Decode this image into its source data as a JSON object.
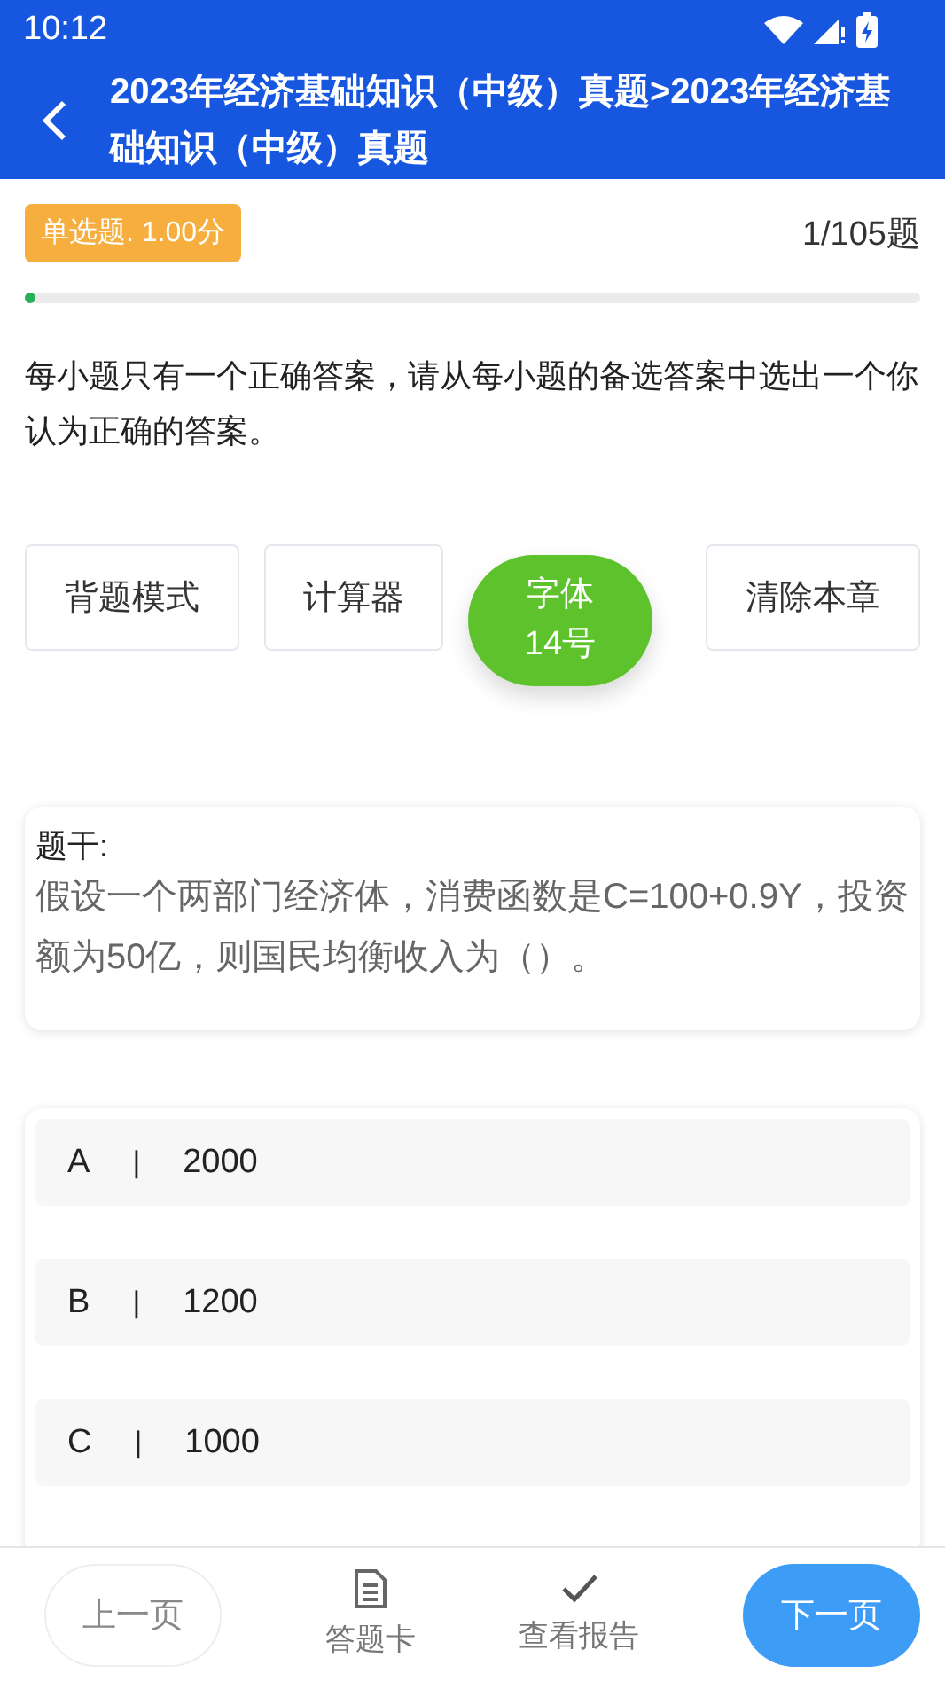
{
  "status_bar": {
    "time": "10:12"
  },
  "header": {
    "title": "2023年经济基础知识（中级）真题>2023年经济基础知识（中级）真题"
  },
  "question_info": {
    "type_tag": "单选题. 1.00分",
    "counter": "1/105题",
    "progress": {
      "level": 0.01
    }
  },
  "instruction": "每小题只有一个正确答案，请从每小题的备选答案中选出一个你认为正确的答案。",
  "tools": [
    {
      "label": "背题模式",
      "kind": "plain"
    },
    {
      "label": "计算器",
      "kind": "plain"
    },
    {
      "label": "字体\n14号",
      "kind": "round"
    },
    {
      "label": "清除本章",
      "kind": "plain"
    }
  ],
  "stem": {
    "label": "题干:",
    "text": "假设一个两部门经济体，消费函数是C=100+0.9Y，投资额为50亿，则国民均衡收入为（）。"
  },
  "options": [
    {
      "letter": "A",
      "separator": "|",
      "text": "2000",
      "selected": false
    },
    {
      "letter": "B",
      "separator": "|",
      "text": "1200",
      "selected": false
    },
    {
      "letter": "C",
      "separator": "|",
      "text": "1000",
      "selected": false
    }
  ],
  "bottom_bar": {
    "prev": "上一页",
    "card": "答题卡",
    "report": "查看报告",
    "next": "下一页"
  }
}
